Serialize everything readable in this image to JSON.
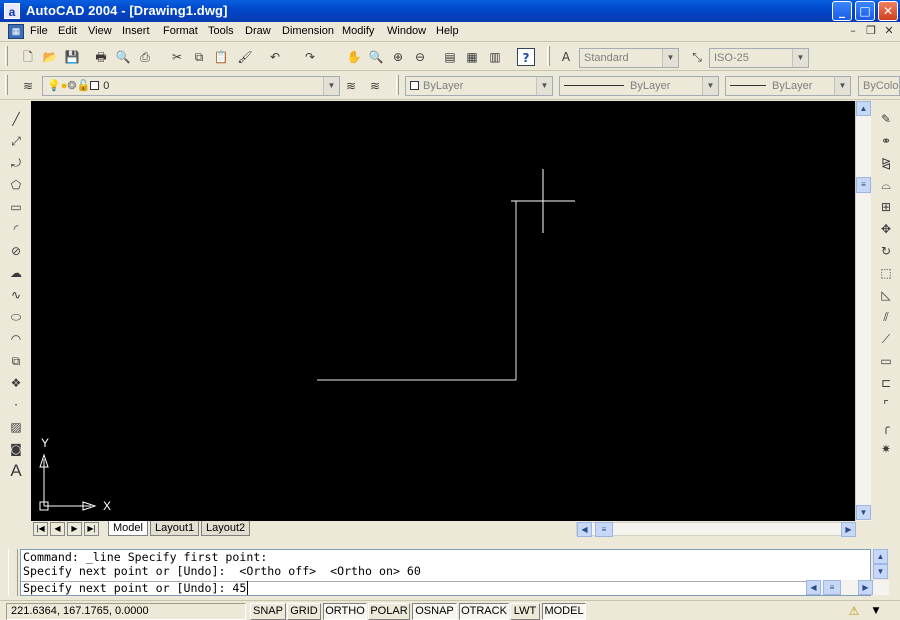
{
  "window": {
    "app_icon": "a",
    "title": "AutoCAD 2004 - [Drawing1.dwg]",
    "controls": {
      "minimize": "_",
      "maximize": "□",
      "close": "✕"
    }
  },
  "menu": {
    "items": [
      "File",
      "Edit",
      "View",
      "Insert",
      "Format",
      "Tools",
      "Draw",
      "Dimension",
      "Modify",
      "Window",
      "Help"
    ],
    "mdi_controls": {
      "minimize": "–",
      "restore": "❐",
      "close": "✕"
    }
  },
  "standard_toolbar": {
    "icons": [
      "new-icon",
      "open-icon",
      "save-icon",
      "print-icon",
      "print-preview-icon",
      "publish-icon",
      "cut-icon",
      "copy-icon",
      "paste-icon",
      "match-properties-icon",
      "undo-icon",
      "redo-icon",
      "pan-icon",
      "zoom-realtime-icon",
      "zoom-window-icon",
      "zoom-previous-icon",
      "properties-icon",
      "design-center-icon",
      "tool-palettes-icon",
      "help-icon"
    ],
    "text_style_value": "Standard",
    "dim_style_value": "ISO-25"
  },
  "layers_toolbar": {
    "layer_value": "0",
    "color_value": "ByLayer",
    "linetype_value": "ByLayer",
    "lineweight_value": "ByLayer",
    "plotstyle_value": "ByColor"
  },
  "draw_toolbar": {
    "icons": [
      "line-icon",
      "construction-line-icon",
      "polyline-icon",
      "polygon-icon",
      "rectangle-icon",
      "arc-icon",
      "circle-icon",
      "revision-cloud-icon",
      "spline-icon",
      "ellipse-icon",
      "ellipse-arc-icon",
      "insert-block-icon",
      "make-block-icon",
      "point-icon",
      "hatch-icon",
      "region-icon",
      "text-icon"
    ]
  },
  "modify_toolbar": {
    "icons": [
      "erase-icon",
      "copy-object-icon",
      "mirror-icon",
      "offset-icon",
      "array-icon",
      "move-icon",
      "rotate-icon",
      "scale-icon",
      "stretch-icon",
      "trim-icon",
      "extend-icon",
      "break-at-point-icon",
      "break-icon",
      "chamfer-icon",
      "fillet-icon",
      "explode-icon"
    ]
  },
  "canvas": {
    "background": "#000000",
    "ucs_x_label": "X",
    "ucs_y_label": "Y"
  },
  "layout_tabs": [
    "Model",
    "Layout1",
    "Layout2"
  ],
  "command_window": {
    "lines": [
      "Command: _line Specify first point:",
      "Specify next point or [Undo]:  <Ortho off>  <Ortho on> 60",
      "Specify next point or [Undo]: 45"
    ]
  },
  "status_bar": {
    "coordinates": "221.6364, 167.1765, 0.0000",
    "toggles": [
      {
        "label": "SNAP",
        "on": false
      },
      {
        "label": "GRID",
        "on": false
      },
      {
        "label": "ORTHO",
        "on": true
      },
      {
        "label": "POLAR",
        "on": false
      },
      {
        "label": "OSNAP",
        "on": true
      },
      {
        "label": "OTRACK",
        "on": true
      },
      {
        "label": "LWT",
        "on": false
      },
      {
        "label": "MODEL",
        "on": true
      }
    ]
  }
}
